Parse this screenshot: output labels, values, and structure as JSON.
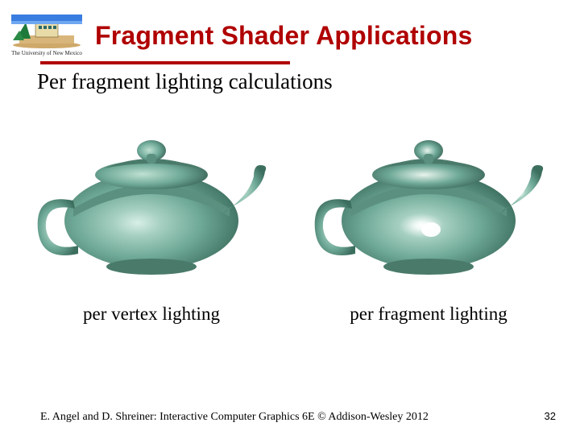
{
  "header": {
    "logo_caption": "The University of New Mexico",
    "title": "Fragment Shader Applications"
  },
  "subtitle": "Per fragment lighting calculations",
  "figures": {
    "left_caption": "per vertex lighting",
    "right_caption": "per fragment lighting"
  },
  "footer": {
    "credit": "E. Angel and D. Shreiner: Interactive Computer Graphics 6E © Addison-Wesley 2012",
    "page": "32"
  },
  "icons": {
    "logo": "unm-logo",
    "teapot": "teapot-icon"
  }
}
